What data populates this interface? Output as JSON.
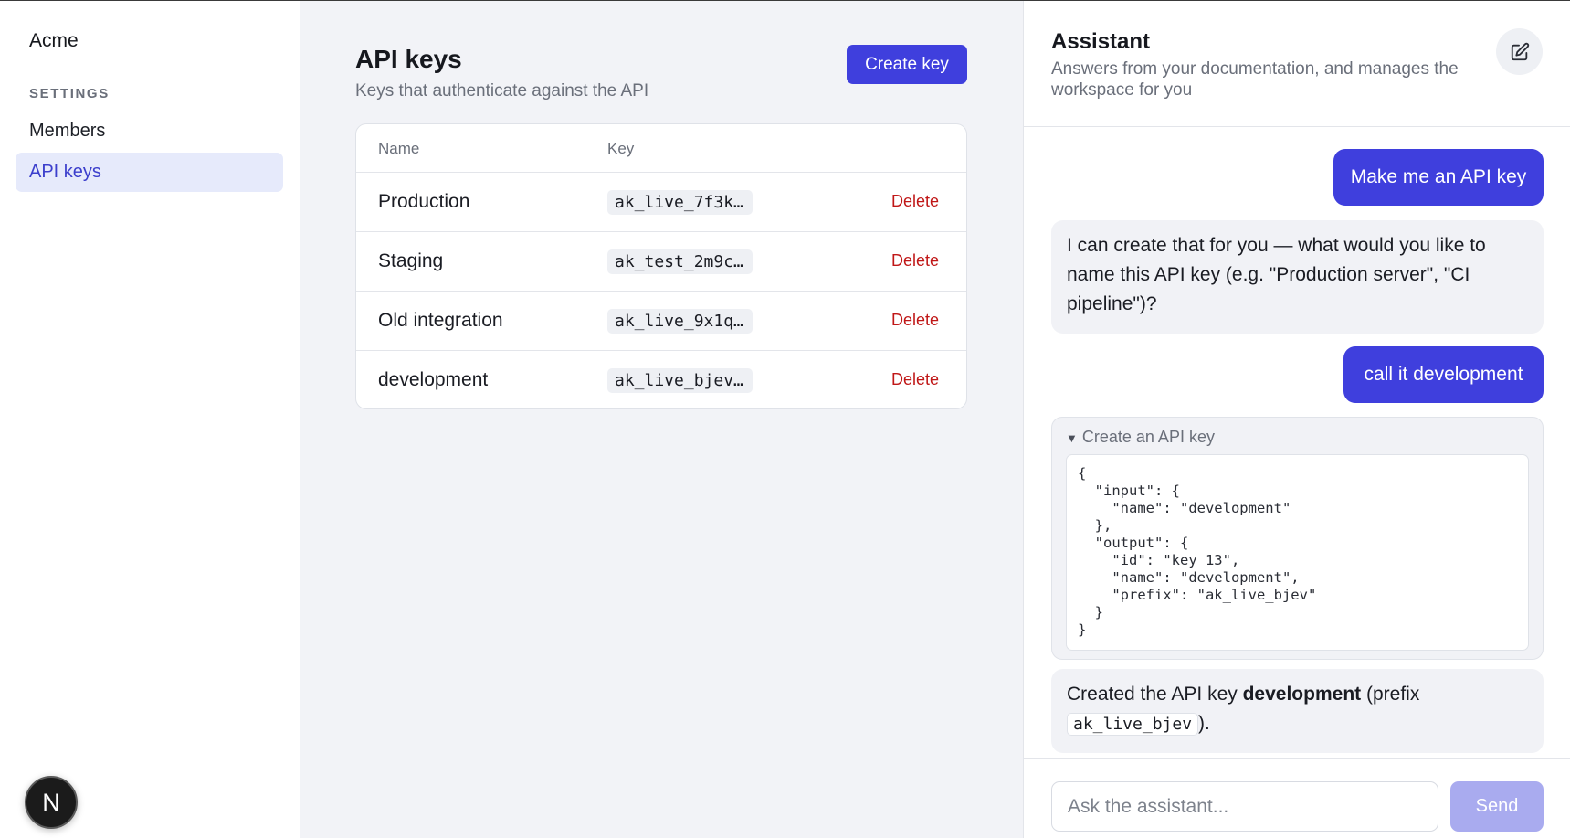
{
  "sidebar": {
    "brand": "Acme",
    "section_label": "SETTINGS",
    "items": [
      {
        "label": "Members"
      },
      {
        "label": "API keys",
        "active": true
      }
    ],
    "avatar_letter": "N"
  },
  "main": {
    "title": "API keys",
    "subtitle": "Keys that authenticate against the API",
    "create_button": "Create key",
    "table": {
      "columns": [
        "Name",
        "Key"
      ],
      "rows": [
        {
          "name": "Production",
          "key": "ak_live_7f3k…",
          "action": "Delete"
        },
        {
          "name": "Staging",
          "key": "ak_test_2m9c…",
          "action": "Delete"
        },
        {
          "name": "Old integration",
          "key": "ak_live_9x1q…",
          "action": "Delete"
        },
        {
          "name": "development",
          "key": "ak_live_bjev…",
          "action": "Delete"
        }
      ]
    }
  },
  "assistant": {
    "title": "Assistant",
    "subtitle": "Answers from your documentation, and manages the workspace for you",
    "messages": [
      {
        "role": "user",
        "text": "Make me an API key"
      },
      {
        "role": "assistant",
        "text": "I can create that for you — what would you like to name this API key (e.g. \"Production server\", \"CI pipeline\")?"
      },
      {
        "role": "user",
        "text": "call it development"
      },
      {
        "role": "tool",
        "summary": "Create an API key",
        "code": "{\n  \"input\": {\n    \"name\": \"development\"\n  },\n  \"output\": {\n    \"id\": \"key_13\",\n    \"name\": \"development\",\n    \"prefix\": \"ak_live_bjev\"\n  }\n}"
      },
      {
        "role": "assistant",
        "text_before": "Created the API key ",
        "bold": "development",
        "text_mid": " (prefix ",
        "code": "ak_live_bjev",
        "text_after": ")."
      }
    ],
    "input_placeholder": "Ask the assistant...",
    "send_label": "Send"
  },
  "colors": {
    "accent": "#3f3fdd",
    "danger": "#c01717",
    "active_nav_bg": "#e6eafb"
  }
}
